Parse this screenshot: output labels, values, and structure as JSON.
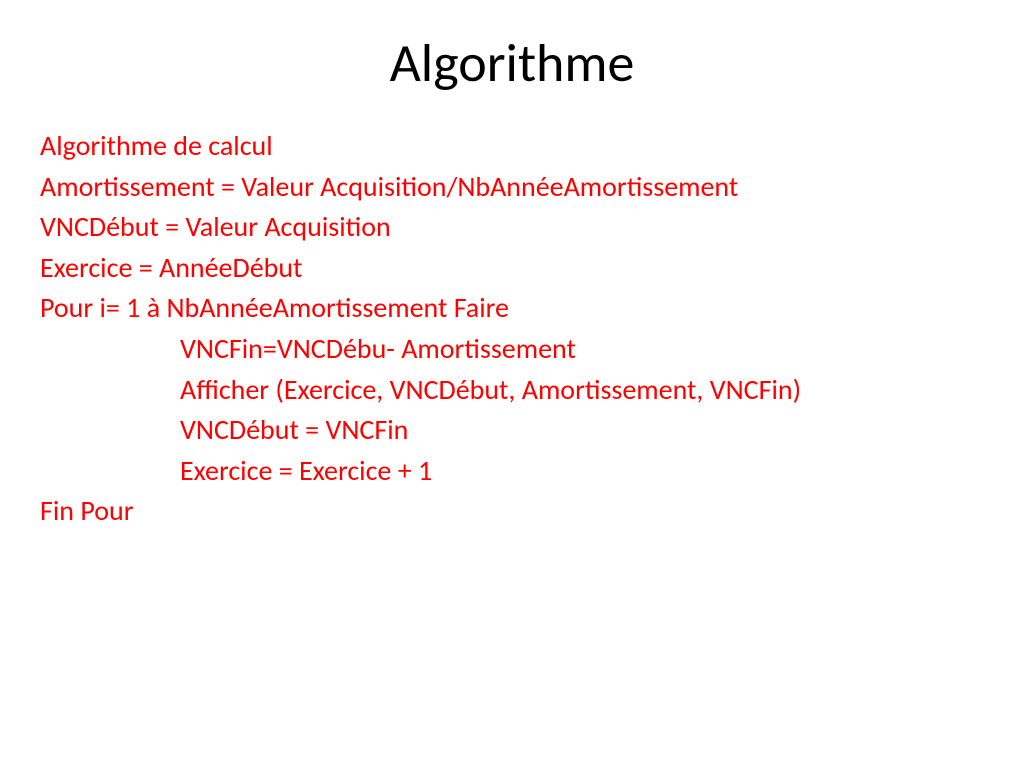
{
  "slide": {
    "title": "Algorithme",
    "lines": {
      "l1": "Algorithme de calcul",
      "l2": "Amortissement = Valeur Acquisition/NbAnnéeAmortissement",
      "l3": "VNCDébut = Valeur Acquisition",
      "l4": "Exercice = AnnéeDébut",
      "l5": "Pour i= 1 à NbAnnéeAmortissement Faire",
      "l6": "VNCFin=VNCDébu- Amortissement",
      "l7": "Afficher (Exercice, VNCDébut, Amortissement, VNCFin)",
      "l8": "VNCDébut = VNCFin",
      "l9": "Exercice = Exercice + 1",
      "l10": "Fin Pour"
    }
  }
}
